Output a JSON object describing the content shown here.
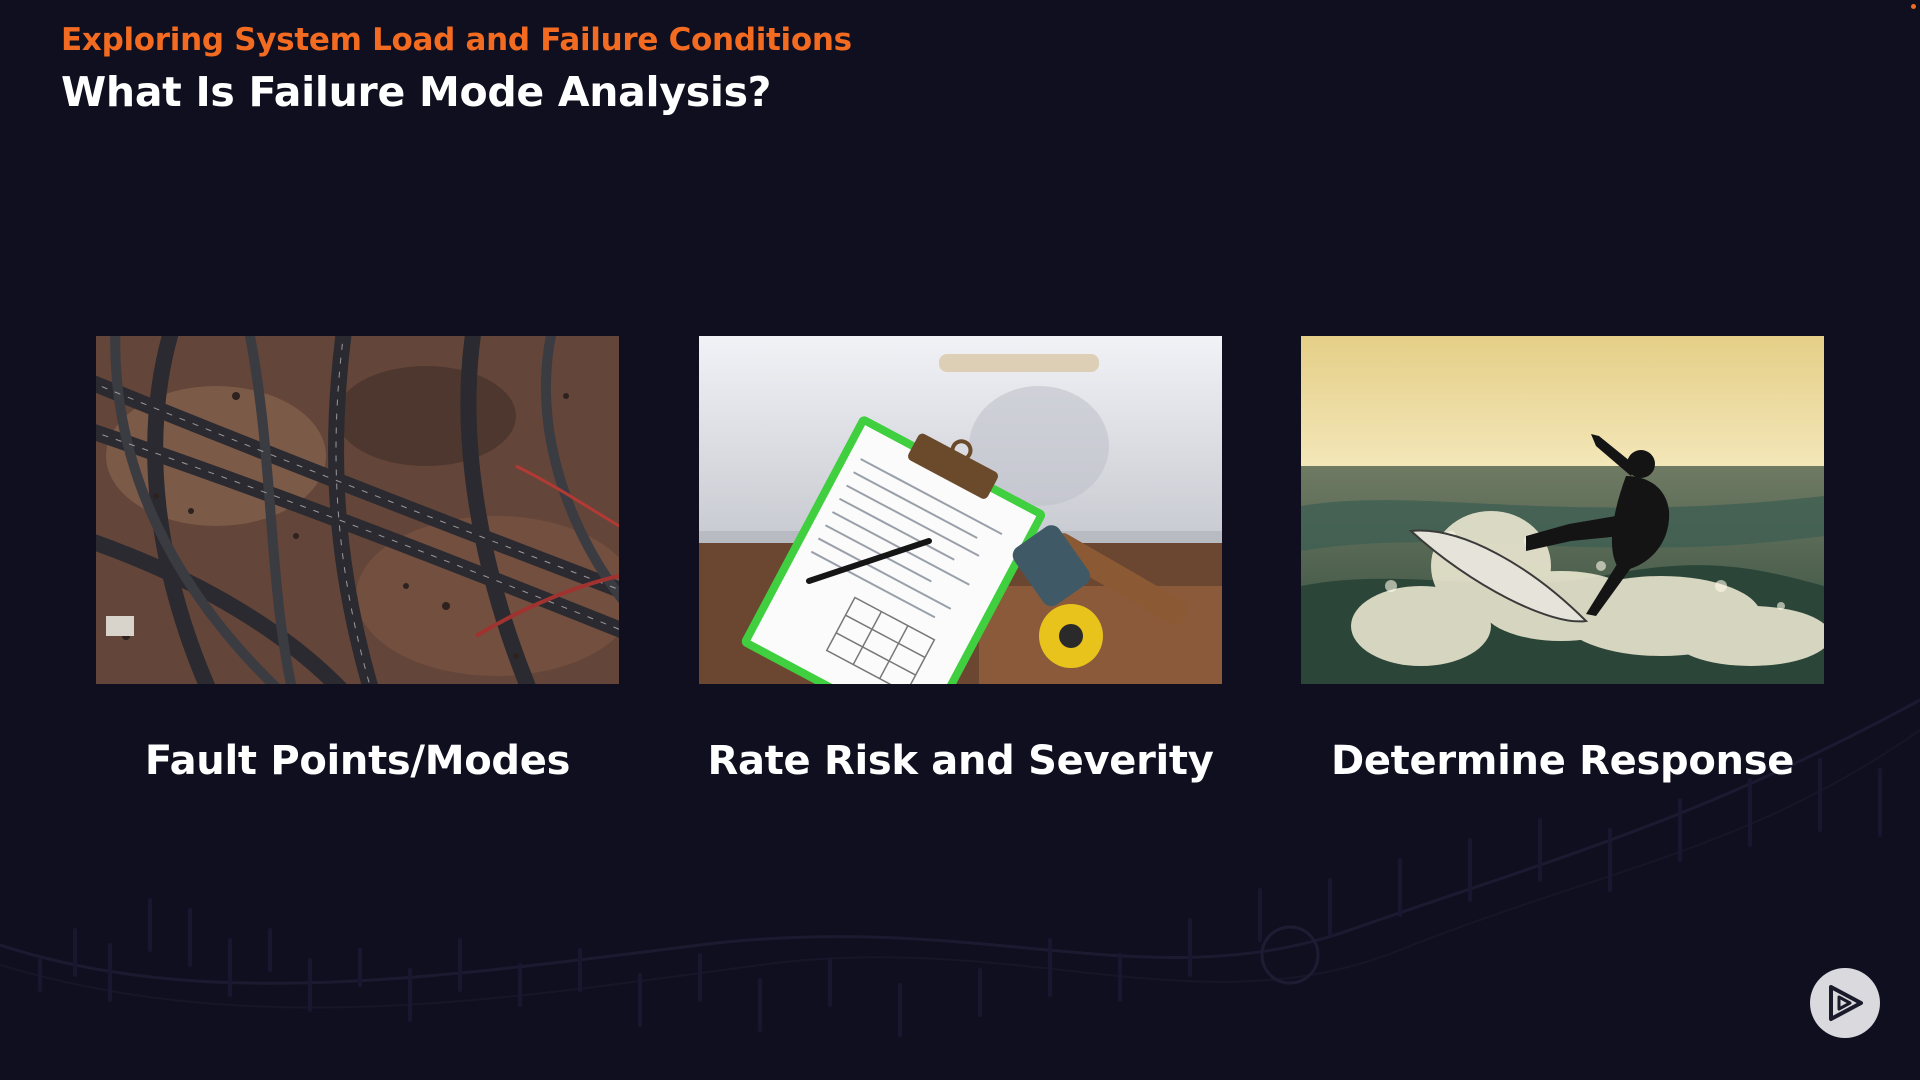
{
  "slide": {
    "eyebrow": "Exploring System Load and Failure Conditions",
    "title": "What Is Failure Mode Analysis?"
  },
  "cards": [
    {
      "label": "Fault Points/Modes",
      "image_icon": "aerial-highway-interchange-photo"
    },
    {
      "label": "Rate Risk and Severity",
      "image_icon": "clipboard-checklist-with-hammer-photo"
    },
    {
      "label": "Determine Response",
      "image_icon": "surfer-on-wave-photo"
    }
  ],
  "colors": {
    "background": "#100f1f",
    "accent": "#f26b21",
    "text": "#ffffff"
  },
  "player": {
    "icon": "play-logo-icon"
  }
}
